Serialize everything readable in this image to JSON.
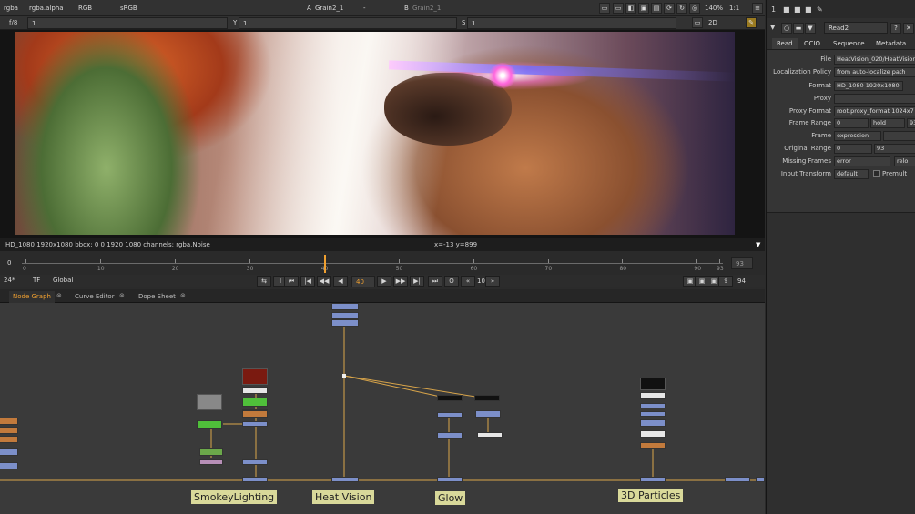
{
  "viewer_toolbar": {
    "row1": {
      "channels": "rgba",
      "alpha": "rgba.alpha",
      "colorspace": "RGB",
      "lut": "sRGB",
      "a_input": "Grain2_1",
      "a_op": "-",
      "b_input": "Grain2_1",
      "zoom": "140%",
      "ratio": "1:1"
    },
    "row2": {
      "fstop": "f/8",
      "gain": "1",
      "gamma_label": "Y",
      "gamma": "1",
      "s_label": "S",
      "s_value": "1",
      "view_mode": "2D"
    }
  },
  "viewer": {
    "status_left": "HD_1080 1920x1080  bbox: 0 0 1920 1080 channels: rgba,Noise",
    "status_coords": "x=-13 y=899"
  },
  "timeline": {
    "start": "0",
    "end": "93",
    "ticks": [
      "0",
      "10",
      "20",
      "30",
      "40",
      "50",
      "60",
      "70",
      "80",
      "90",
      "93"
    ],
    "current_frame": 40,
    "total_frames": 93
  },
  "playback": {
    "fps": "24*",
    "tf": "TF",
    "scope": "Global",
    "frame": "40",
    "step": "10",
    "end_frame": "94"
  },
  "tabs": [
    {
      "label": "Node Graph",
      "active": true
    },
    {
      "label": "Curve Editor",
      "active": false
    },
    {
      "label": "Dope Sheet",
      "active": false
    }
  ],
  "backdrops": [
    {
      "label": "SmokeyLighting"
    },
    {
      "label": "Heat Vision"
    },
    {
      "label": "Glow"
    },
    {
      "label": "3D Particles"
    }
  ],
  "properties": {
    "node_name": "Read2",
    "tabs": [
      "Read",
      "OCIO",
      "Sequence",
      "Metadata"
    ],
    "rows": [
      {
        "label": "File",
        "value": "HeatVision_020/HeatVision"
      },
      {
        "label": "Localization Policy",
        "value": "from auto-localize path"
      },
      {
        "label": "Format",
        "value": "HD_1080 1920x1080"
      },
      {
        "label": "Proxy",
        "value": ""
      },
      {
        "label": "Proxy Format",
        "value": "root.proxy_format 1024x7"
      },
      {
        "label": "Frame Range",
        "value": "0",
        "extra": "hold",
        "extra2": "93"
      },
      {
        "label": "Frame",
        "value": "expression"
      },
      {
        "label": "Original Range",
        "value": "0",
        "extra": "93"
      },
      {
        "label": "Missing Frames",
        "value": "error",
        "extra": "relo"
      },
      {
        "label": "Input Transform",
        "value": "default",
        "extra": "Premult"
      }
    ]
  },
  "colors": {
    "accent": "#f0a030",
    "node_blue": "#7c8fc9",
    "backdrop": "#d9d99a"
  }
}
